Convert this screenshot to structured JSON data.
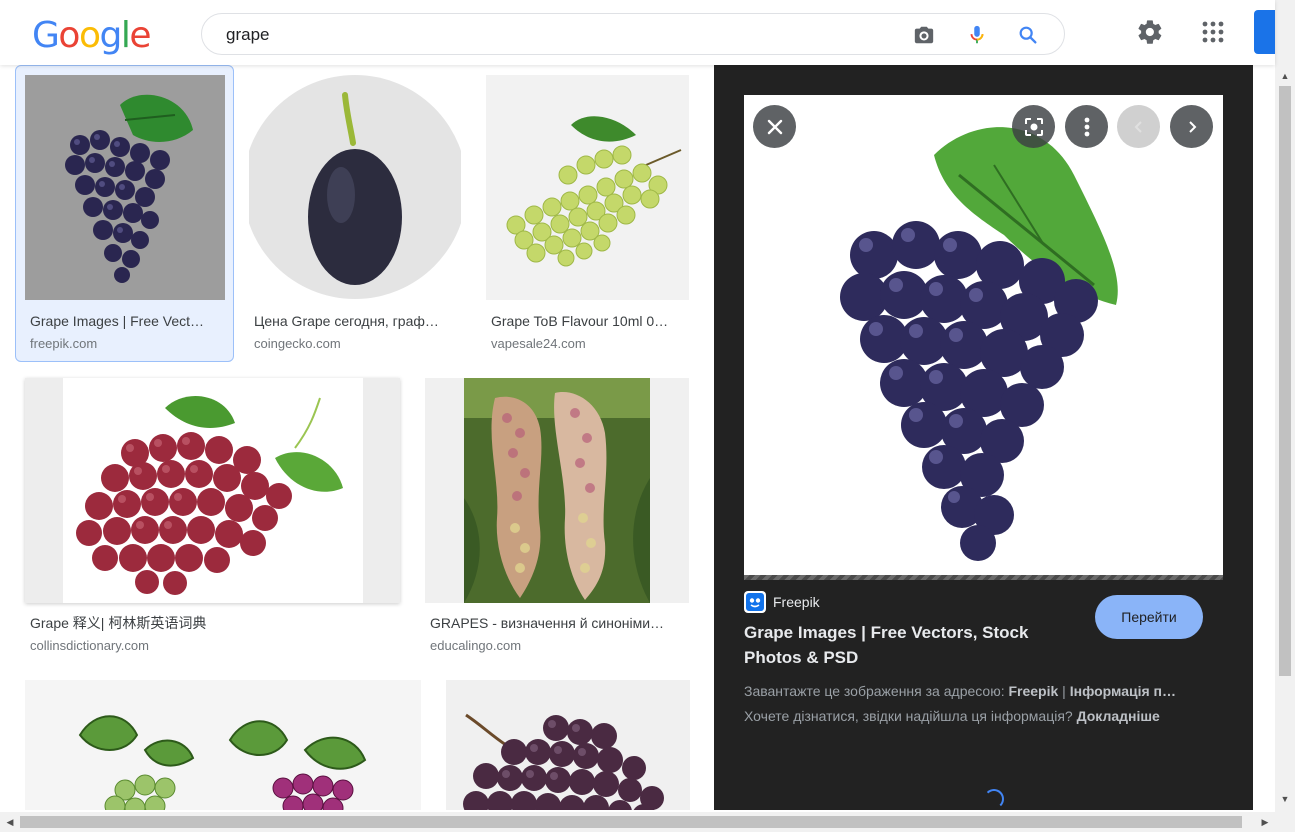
{
  "header": {
    "logo_letters": [
      {
        "ch": "G",
        "color": "#4285F4"
      },
      {
        "ch": "o",
        "color": "#EA4335"
      },
      {
        "ch": "o",
        "color": "#FBBC05"
      },
      {
        "ch": "g",
        "color": "#4285F4"
      },
      {
        "ch": "l",
        "color": "#34A853"
      },
      {
        "ch": "e",
        "color": "#EA4335"
      }
    ],
    "search_value": "grape",
    "icons": [
      "camera-icon",
      "microphone-icon",
      "search-icon",
      "settings-gear-icon",
      "apps-grid-icon"
    ]
  },
  "results": [
    {
      "title": "Grape Images | Free Vect…",
      "source": "freepik.com",
      "selected": true
    },
    {
      "title": "Цена Grape сегодня, граф…",
      "source": "coingecko.com"
    },
    {
      "title": "Grape ToB Flavour 10ml 0…",
      "source": "vapesale24.com"
    },
    {
      "title": "Grape 释义| 柯林斯英语词典",
      "source": "collinsdictionary.com"
    },
    {
      "title": "GRAPES - визначення й синоніми…",
      "source": "educalingo.com"
    },
    {
      "title": "",
      "source": ""
    },
    {
      "title": "",
      "source": ""
    }
  ],
  "panel": {
    "source_name": "Freepik",
    "title": "Grape Images | Free Vectors, Stock Photos & PSD",
    "visit_label": "Перейти",
    "download_prefix": "Завантажте це зображення за адресою:",
    "download_source": "Freepik",
    "download_sep": " | ",
    "download_link": "Інформація п…",
    "info_prefix": "Хочете дізнатися, звідки надійшла ця інформація?",
    "info_link": "Докладніше"
  },
  "colors": {
    "accent": "#1a73e8",
    "panel_bg": "#222222",
    "visit_button": "#8ab4f8",
    "selected_card_bg": "#e8f0fe"
  }
}
